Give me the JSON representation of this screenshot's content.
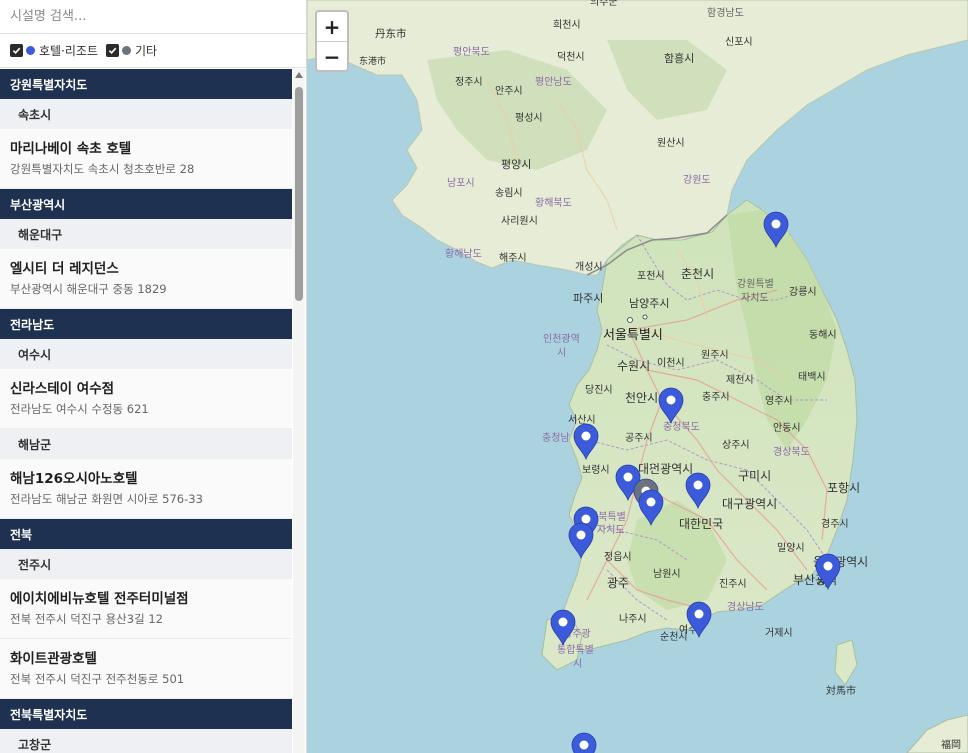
{
  "search": {
    "placeholder": "시설명 검색..."
  },
  "filters": [
    {
      "label": "호텔·리조트",
      "color": "#3b5bdb",
      "checked": true
    },
    {
      "label": "기타",
      "color": "#6b7280",
      "checked": true
    }
  ],
  "list": {
    "gangwon": {
      "region": "강원특별자치도",
      "city": "속초시",
      "items": [
        {
          "name": "마리나베이 속초 호텔",
          "address": "강원특별자치도 속초시 청초호반로 28"
        }
      ]
    },
    "busan": {
      "region": "부산광역시",
      "city": "해운대구",
      "items": [
        {
          "name": "엘시티 더 레지던스",
          "address": "부산광역시 해운대구 중동 1829"
        }
      ]
    },
    "jeonnam": {
      "region": "전라남도",
      "city1": "여수시",
      "items1": [
        {
          "name": "신라스테이 여수점",
          "address": "전라남도 여수시 수정동 621"
        }
      ],
      "city2": "해남군",
      "items2": [
        {
          "name": "해남126오시아노호텔",
          "address": "전라남도 해남군 화원면 시아로 576-33"
        }
      ]
    },
    "jeonbuk": {
      "region": "전북",
      "city": "전주시",
      "items": [
        {
          "name": "에이치에비뉴호텔 전주터미널점",
          "address": "전북 전주시 덕진구 용산3길 12"
        },
        {
          "name": "화이트관광호텔",
          "address": "전북 전주시 덕진구 전주천동로 501"
        }
      ]
    },
    "jeonbuk2": {
      "region": "전북특별자치도",
      "city": "고창군"
    }
  },
  "map": {
    "zoom_in": "+",
    "zoom_out": "−",
    "labels": {
      "dandong": "丹东市",
      "donggang": "东港市",
      "uiju": "의주군",
      "huichon": "희천시",
      "hamgyongnamdo": "함경남도",
      "sinpo": "신포시",
      "hamhung": "함흥시",
      "pyonganbukdo": "평안북도",
      "tokchon": "덕천시",
      "jongju": "정주시",
      "pyongannamdo": "평안남도",
      "anju": "안주시",
      "pyongsong": "평성시",
      "wonsan": "원산시",
      "pyongyang": "평양시",
      "nampo": "남포시",
      "songnim": "송림시",
      "kangwondo_n": "강원도",
      "hwanghaebukdo": "황해북도",
      "sariwon": "사리원시",
      "hwanghaenamdo": "황해남도",
      "haeju": "해주시",
      "kaesong": "개성시",
      "pocheon": "포천시",
      "chuncheon": "춘천시",
      "gangwon_sp": "강원특별",
      "gangwon_sp2": "자치도",
      "gangneung": "강릉시",
      "paju": "파주시",
      "namyangju": "남양주시",
      "incheon": "인천광역",
      "incheon2": "시",
      "seoul": "서울특별시",
      "icheon": "이천시",
      "wonju": "원주시",
      "donghae": "동해시",
      "suwon": "수원시",
      "jecheon": "제천시",
      "taebaek": "태백시",
      "dangjin": "당진시",
      "cheonan": "천안시",
      "chungju": "충주시",
      "yeongju": "영주시",
      "seosan": "서산시",
      "chungbuk": "충청북도",
      "andong": "안동시",
      "chungnam": "충청남",
      "gongju": "공주시",
      "sangju": "상주시",
      "gyeongbuk": "경상북도",
      "boryeong": "보령시",
      "daejeon": "대전광역시",
      "gumi": "구미시",
      "pohang": "포항시",
      "jeonbuk_sp": "전북특별",
      "jeonbuk_sp2": "자치도",
      "daegu": "대구광역시",
      "korea": "대한민국",
      "gyeongju": "경주시",
      "miryang": "밀양시",
      "jeongeup": "정읍시",
      "namwon": "남원시",
      "ulsan": "울산광역시",
      "gwangju": "광주",
      "jinju": "진주시",
      "busan": "부산광역",
      "busan2": "시",
      "naju": "나주시",
      "gyeongnam": "경상남도",
      "suncheon": "순천시",
      "yeosu": "여수",
      "geoje": "거제시",
      "gwangju_m": "광주광",
      "jeju_sp": "통합특별",
      "jeju_sp2": "시",
      "tsushima": "対馬市",
      "fukuoka": "福岡"
    }
  }
}
